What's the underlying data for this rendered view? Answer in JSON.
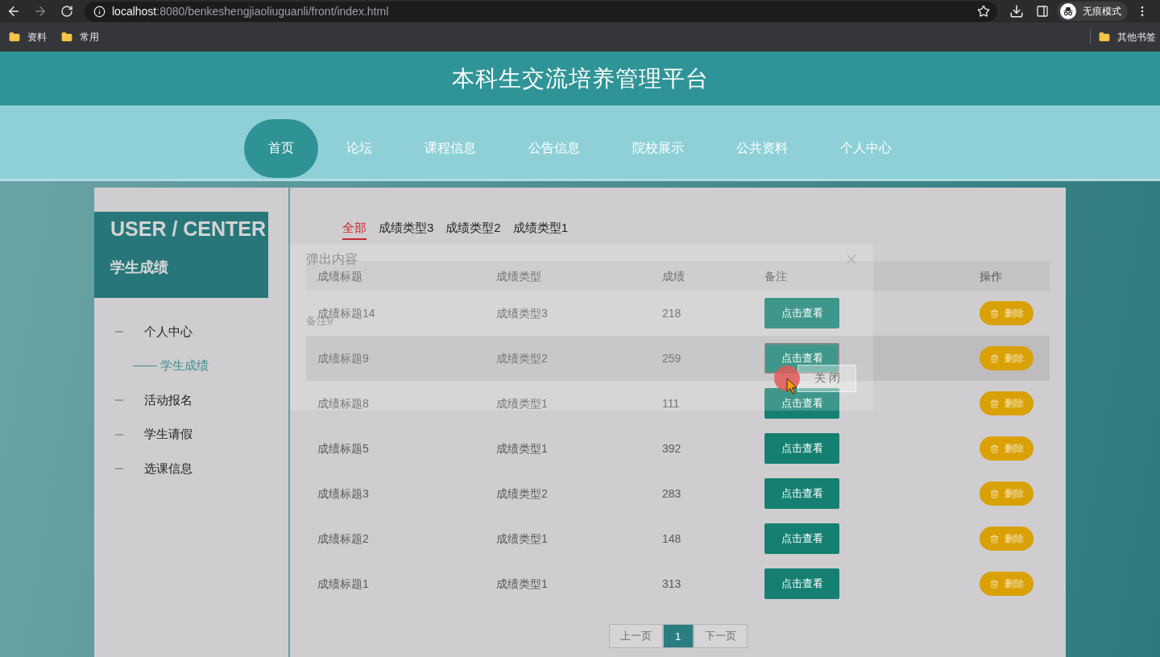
{
  "browser": {
    "url_host": "localhost",
    "url_path": ":8080/benkeshengjiaoliuguanli/front/index.html",
    "profile_label": "无痕模式",
    "bookmarks": [
      {
        "label": "资料"
      },
      {
        "label": "常用"
      }
    ],
    "other_bookmarks": {
      "label": "其他书签"
    }
  },
  "header": {
    "title": "本科生交流培养管理平台"
  },
  "nav": [
    {
      "label": "首页",
      "selected": true
    },
    {
      "label": "论坛",
      "selected": false
    },
    {
      "label": "课程信息",
      "selected": false
    },
    {
      "label": "公告信息",
      "selected": false
    },
    {
      "label": "院校展示",
      "selected": false
    },
    {
      "label": "公共资料",
      "selected": false
    },
    {
      "label": "个人中心",
      "selected": false
    }
  ],
  "sidebar": {
    "heading": "USER / CENTER",
    "subheading": "学生成绩",
    "items": [
      {
        "label": "个人中心",
        "selected": false,
        "children": [
          {
            "label": "学生成绩",
            "selected": true
          }
        ]
      },
      {
        "label": "活动报名",
        "selected": false
      },
      {
        "label": "学生请假",
        "selected": false
      },
      {
        "label": "选课信息",
        "selected": false
      }
    ]
  },
  "filter_tabs": [
    {
      "label": "全部",
      "selected": true
    },
    {
      "label": "成绩类型3",
      "selected": false
    },
    {
      "label": "成绩类型2",
      "selected": false
    },
    {
      "label": "成绩类型1",
      "selected": false
    }
  ],
  "table": {
    "columns": [
      "成绩标题",
      "成绩类型",
      "成绩",
      "备注",
      "操作"
    ],
    "rows": [
      {
        "title": "成绩标题14",
        "type": "成绩类型3",
        "score": "218",
        "view_label": "点击查看",
        "delete_label": "删除",
        "highlighted": false,
        "focused": false
      },
      {
        "title": "成绩标题9",
        "type": "成绩类型2",
        "score": "259",
        "view_label": "点击查看",
        "delete_label": "删除",
        "highlighted": true,
        "focused": true
      },
      {
        "title": "成绩标题8",
        "type": "成绩类型1",
        "score": "111",
        "view_label": "点击查看",
        "delete_label": "删除",
        "highlighted": false,
        "focused": false
      },
      {
        "title": "成绩标题5",
        "type": "成绩类型1",
        "score": "392",
        "view_label": "点击查看",
        "delete_label": "删除",
        "highlighted": false,
        "focused": false
      },
      {
        "title": "成绩标题3",
        "type": "成绩类型2",
        "score": "283",
        "view_label": "点击查看",
        "delete_label": "删除",
        "highlighted": false,
        "focused": false
      },
      {
        "title": "成绩标题2",
        "type": "成绩类型1",
        "score": "148",
        "view_label": "点击查看",
        "delete_label": "删除",
        "highlighted": false,
        "focused": false
      },
      {
        "title": "成绩标题1",
        "type": "成绩类型1",
        "score": "313",
        "view_label": "点击查看",
        "delete_label": "删除",
        "highlighted": false,
        "focused": false
      }
    ]
  },
  "pagination": {
    "prev": {
      "label": "上一页",
      "disabled": true
    },
    "pages": [
      {
        "label": "1",
        "selected": true
      }
    ],
    "next": {
      "label": "下一页",
      "disabled": true
    }
  },
  "dialog": {
    "title": "弹出内容",
    "body": "备注9",
    "close_label": "关闭"
  }
}
